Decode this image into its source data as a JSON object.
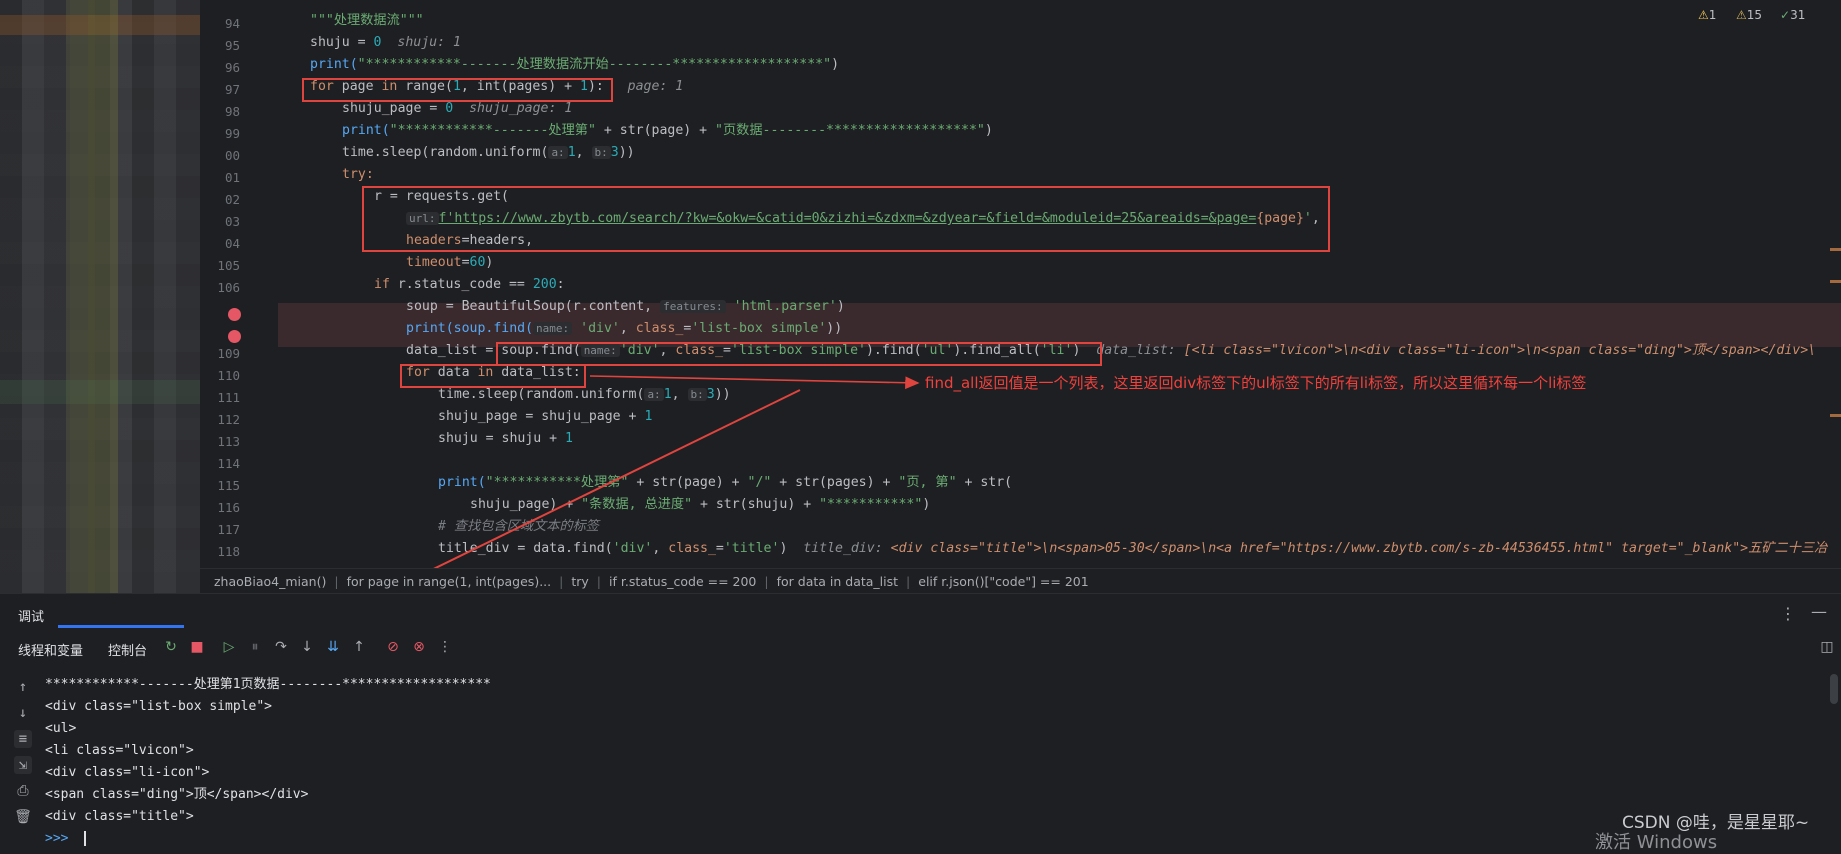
{
  "editor": {
    "warnings": {
      "warn": "1",
      "weak": "15",
      "ok": "31"
    },
    "line_numbers": [
      "94",
      "95",
      "96",
      "97",
      "98",
      "99",
      "00",
      "01",
      "02",
      "03",
      "04",
      "105",
      "106",
      "",
      "",
      "109",
      "110",
      "111",
      "112",
      "113",
      "114",
      "115",
      "116",
      "117",
      "118"
    ],
    "lines": {
      "l94": "\"\"\"处理数据流\"\"\"",
      "l95_a": "shuju = ",
      "l95_b": "0",
      "l95_c": "shuju: 1",
      "l96_a": "print(",
      "l96_b": "\"************-------处理数据流开始--------*******************\"",
      "l96_c": ")",
      "l97_a": "for",
      "l97_b": " page ",
      "l97_c": "in",
      "l97_d": " range(",
      "l97_e": "1",
      "l97_f": ", int(pages) + ",
      "l97_g": "1",
      "l97_h": "):",
      "l97_i": "page: 1",
      "l98_a": "shuju_page = ",
      "l98_b": "0",
      "l98_c": "shuju_page: 1",
      "l99_a": "print(",
      "l99_b": "\"************-------处理第\"",
      "l99_c": " + str(page) + ",
      "l99_d": "\"页数据--------*******************\"",
      "l99_e": ")",
      "l100_a": "time.sleep(random.uniform(",
      "l100_b": "a:",
      "l100_c": "1",
      "l100_d": ", ",
      "l100_e": "b:",
      "l100_f": "3",
      "l100_g": "))",
      "l101": "try:",
      "l102": "r = requests.get(",
      "l103_a": "url:",
      "l103_b": "f'https://www.zbytb.com/search/?kw=&okw=&catid=0&zizhi=&zdxm=&zdyear=&field=&moduleid=25&areaids=&page=",
      "l103_c": "{page}",
      "l103_d": "'",
      "l103_e": ",",
      "l104_a": "headers",
      "l104_b": "=headers,",
      "l105_a": "timeout",
      "l105_b": "=",
      "l105_c": "60",
      "l105_d": ")",
      "l106_a": "if",
      "l106_b": " r.status_code == ",
      "l106_c": "200",
      "l106_d": ":",
      "l107_a": "soup = BeautifulSoup(r.content, ",
      "l107_b": "features:",
      "l107_c": "'html.parser'",
      "l107_d": ")",
      "l108_a": "print(soup.find(",
      "l108_b": "name:",
      "l108_c": "'div'",
      "l108_d": ", ",
      "l108_e": "class_",
      "l108_f": "=",
      "l108_g": "'list-box simple'",
      "l108_h": "))",
      "l109_a": "data_list = ",
      "l109_b": "soup.find(",
      "l109_c": "name:",
      "l109_d": "'div'",
      "l109_e": ", ",
      "l109_f": "class_",
      "l109_g": "=",
      "l109_h": "'list-box simple'",
      "l109_i": ").find(",
      "l109_j": "'ul'",
      "l109_k": ").find_all(",
      "l109_l": "'li'",
      "l109_m": ")",
      "l109_hint_a": "data_list: ",
      "l109_hint_b": "[<li class=\"lvicon\">\\n<div class=\"li-icon\">\\n<span class=\"ding\">顶</span></div>\\",
      "l110_a": "for",
      "l110_b": " data ",
      "l110_c": "in",
      "l110_d": " data_list:",
      "l111_a": "time.sleep(random.uniform(",
      "l111_b": "a:",
      "l111_c": "1",
      "l111_d": ", ",
      "l111_e": "b:",
      "l111_f": "3",
      "l111_g": "))",
      "l112_a": "shuju_page = shuju_page + ",
      "l112_b": "1",
      "l113_a": "shuju = shuju + ",
      "l113_b": "1",
      "l115_a": "print(",
      "l115_b": "\"***********处理第\"",
      "l115_c": " + str(page) + ",
      "l115_d": "\"/\"",
      "l115_e": " + str(pages) + ",
      "l115_f": "\"页, 第\"",
      "l115_g": " + str(",
      "l116_a": "shuju_page) + ",
      "l116_b": "\"条数据, 总进度\"",
      "l116_c": " + str(shuju) + ",
      "l116_d": "\"***********\"",
      "l116_e": ")",
      "l117": "# 查找包含区域文本的标签",
      "l118_a": "title_div = data.find(",
      "l118_b": "'div'",
      "l118_c": ", ",
      "l118_d": "class_",
      "l118_e": "=",
      "l118_f": "'title'",
      "l118_g": ")",
      "l118_hint_a": "title_div: ",
      "l118_hint_b": "<div class=\"title\">\\n<span>05-30</span>\\n<a href=\"https://www.zbytb.com/s-zb-44536455.html\" target=\"_blank\">五矿二十三冶"
    }
  },
  "annotation": "find_all返回值是一个列表，这里返回div标签下的ul标签下的所有li标签，所以这里循环每一个li标签",
  "breadcrumbs": [
    "zhaoBiao4_mian()",
    "for page in range(1, int(pages)...",
    "try",
    "if r.status_code == 200",
    "for data in data_list",
    "elif r.json()[\"code\"] == 201"
  ],
  "debug": {
    "title": "调试",
    "tabs": [
      "线程和变量",
      "控制台"
    ],
    "console": [
      "************-------处理第1页数据--------*******************",
      "<div class=\"list-box simple\">",
      "<ul>",
      "<li class=\"lvicon\">",
      "<div class=\"li-icon\">",
      "<span class=\"ding\">顶</span></div>",
      "<div class=\"title\">",
      ">>>"
    ]
  },
  "watermark": {
    "csdn": "CSDN @哇，是星星耶~",
    "windows": "激活 Windows"
  },
  "colors": {
    "accent": "#3574f0",
    "annotation_red": "#e0443e",
    "breakpoint": "#e55765"
  }
}
